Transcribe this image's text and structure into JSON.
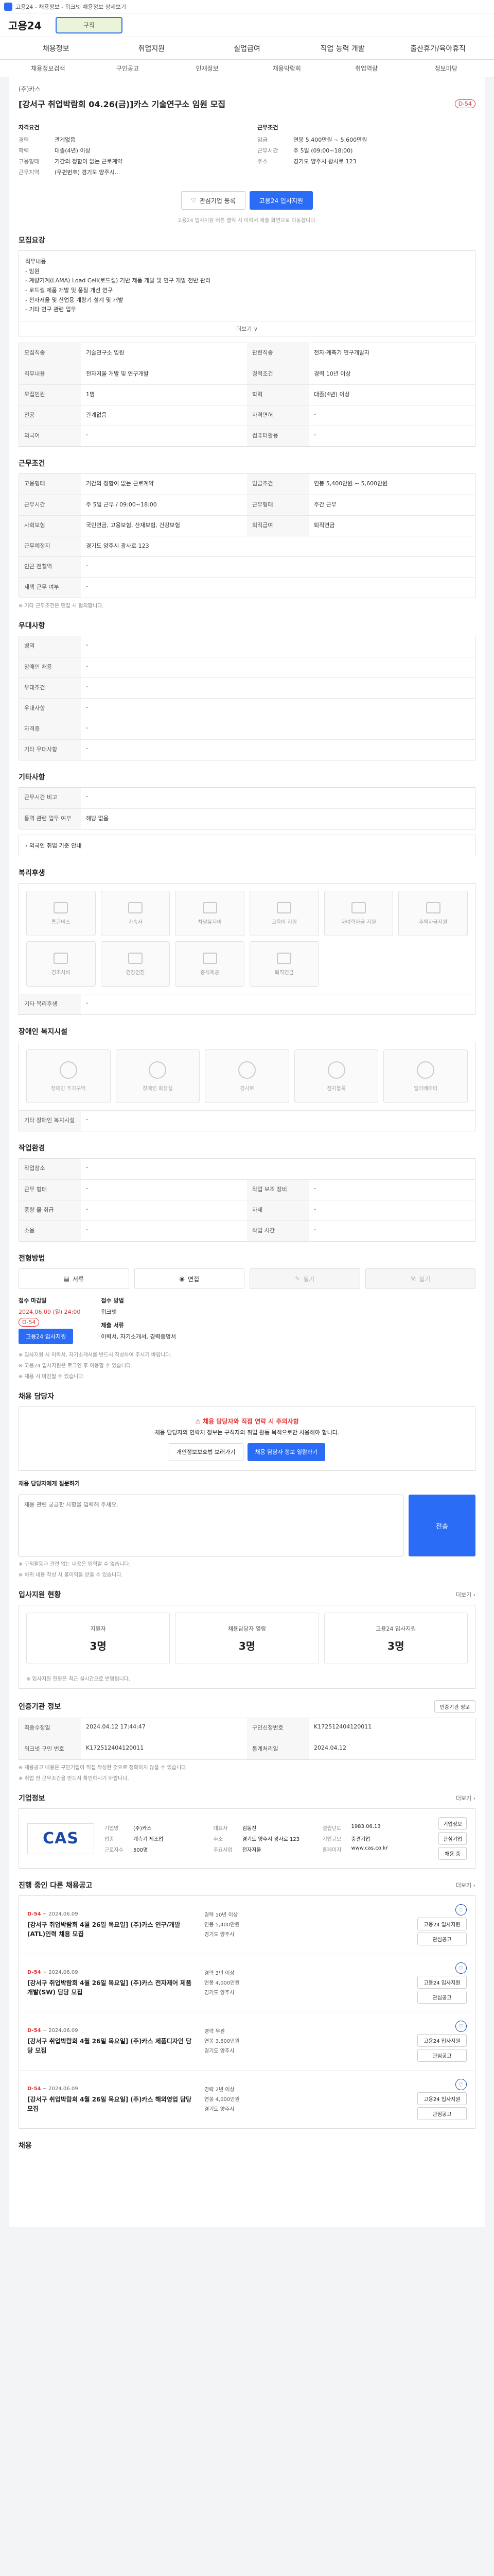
{
  "topbar": {
    "text": "고용24 - 채용정보 - 워크넷 채용정보 상세보기"
  },
  "header": {
    "logo": "고용24",
    "search_placeholder": "구직",
    "nav": [
      "채용정보",
      "취업지원",
      "실업급여",
      "직업 능력 개발",
      "출산휴가/육아휴직"
    ]
  },
  "subnav": [
    "채용정보검색",
    "구인공고",
    "인재정보",
    "채용박람회",
    "취업역량",
    "정보마당"
  ],
  "job": {
    "company": "(주)카스",
    "title": "[강서구 취업박람회 04.26(금)]카스 기술연구소 임원 모집",
    "dday": "D-54",
    "left_label": "자격요건",
    "left": [
      [
        "경력",
        "관계없음"
      ],
      [
        "학력",
        "대졸(4년) 이상"
      ],
      [
        "고용형태",
        "기간의 정함이 없는 근로계약"
      ],
      [
        "근무지역",
        "(우편번호) 경기도 양주시..."
      ]
    ],
    "right_label": "근무조건",
    "right": [
      [
        "임금",
        "연봉 5,400만원 ~ 5,600만원"
      ],
      [
        "근무시간",
        "주 5일 (09:00~18:00)"
      ],
      [
        "주소",
        "경기도 양주시 광사로 123"
      ]
    ],
    "btn_like": "관심기업 등록",
    "btn_apply": "고용24 입사지원",
    "fine": "고용24 입사지원 버튼 클릭 시 이력서 제출 화면으로 이동합니다."
  },
  "sections": {
    "recruit": "모집요강",
    "condition": "근무조건",
    "welfare": "우대사항",
    "etc": "기타사항",
    "facility": "복리후생",
    "access": "장애인 복지시설",
    "company_info": "작업환경",
    "apply_method": "전형방법",
    "contact": "채용 담당자",
    "stats": "입사지원 현황",
    "period": "인증기관 정보",
    "corp": "기업정보",
    "other_jobs": "진행 중인 다른 채용공고",
    "bottom": "채용"
  },
  "recruit": {
    "desc": "직무내용\n- 임원\n- 계량기계(LAMA) Load Cell(로드셀) 기반 제품 개발 및 연구 개발 전반 관리\n- 로드셀 제품 개발 및 품질 개선 연구\n- 전자저울 및 산업용 계량기 설계 및 개발\n- 기타 연구 관련 업무",
    "more": "더보기 ∨",
    "rows": [
      [
        "모집직종",
        "기술연구소 임원",
        "관련직종",
        "전자·계측기 연구개발자"
      ],
      [
        "직무내용",
        "전자저울 개발 및 연구개발",
        "경력조건",
        "경력 10년 이상"
      ],
      [
        "모집인원",
        "1명",
        "학력",
        "대졸(4년) 이상"
      ],
      [
        "전공",
        "관계없음",
        "자격면허",
        "-"
      ],
      [
        "외국어",
        "-",
        "컴퓨터활용",
        "-"
      ]
    ]
  },
  "condition": {
    "rows": [
      [
        "고용형태",
        "기간의 정함이 없는 근로계약",
        "임금조건",
        "연봉 5,400만원 ~ 5,600만원"
      ],
      [
        "근무시간",
        "주 5일 근무 / 09:00~18:00",
        "근무형태",
        "주간 근무"
      ],
      [
        "사회보험",
        "국민연금, 고용보험, 산재보험, 건강보험",
        "퇴직급여",
        "퇴직연금"
      ],
      [
        "근무예정지",
        "경기도 양주시 광사로 123",
        "",
        ""
      ],
      [
        "인근 전철역",
        "-",
        "",
        ""
      ],
      [
        "재택 근무 여부",
        "-",
        "",
        ""
      ]
    ],
    "note": "※ 기타 근무조건은 면접 시 협의합니다."
  },
  "welfare": {
    "rows": [
      [
        "병역",
        "-"
      ],
      [
        "장애인 채용",
        "-"
      ],
      [
        "우대조건",
        "-"
      ],
      [
        "우대사항",
        "-"
      ],
      [
        "자격증",
        "-"
      ],
      [
        "기타 우대사항",
        "-"
      ]
    ]
  },
  "etc": {
    "rows": [
      [
        "근무시간 비고",
        "-"
      ],
      [
        "통역 관련 업무 여부",
        "해당 없음"
      ]
    ],
    "link": "› 외국인 취업 기준 안내"
  },
  "facility": {
    "items": [
      "통근버스",
      "기숙사",
      "차량유지비",
      "교육비 지원",
      "자녀학자금 지원",
      "주택자금지원",
      "경조사비",
      "건강검진",
      "중식제공",
      "퇴직연금"
    ],
    "note": "기타 복리후생",
    "note_val": "-"
  },
  "access": {
    "items": [
      "장애인 주차구역",
      "장애인 화장실",
      "경사로",
      "점자블록",
      "엘리베이터"
    ],
    "note": "기타 장애인 복지시설",
    "note_val": "-"
  },
  "company_env": {
    "rows": [
      [
        "작업장소",
        "-",
        "",
        ""
      ],
      [
        "근무 형태",
        "-",
        "작업 보조 장비",
        "-"
      ],
      [
        "중량 물 취급",
        "-",
        "자세",
        "-"
      ],
      [
        "소음",
        "-",
        "작업 시간",
        "-"
      ]
    ]
  },
  "apply": {
    "methods": [
      "서류",
      "면접",
      "필기",
      "실기"
    ],
    "doc_label": "접수 마감일",
    "doc_date": "2024.06.09 (일) 24:00",
    "method_label": "접수 방법",
    "method_val": "워크넷",
    "dday": "D-54",
    "apply_btn": "고용24 입사지원",
    "files_label": "제출 서류",
    "files_val": "이력서, 자기소개서, 경력증명서",
    "notes": [
      "※ 입사지원 시 이력서, 자기소개서를 반드시 작성하여 주시기 바랍니다.",
      "※ 고용24 입사지원은 로그인 후 이용할 수 있습니다.",
      "※ 채용 시 마감될 수 있습니다."
    ]
  },
  "contact": {
    "warn_title": "채용 담당자와 직접 연락 시 주의사항",
    "warn_body": "채용 담당자의 연락처 정보는 구직자의 취업 활동 목적으로만 사용해야 합니다.",
    "btn1": "개인정보보호법 보러가기",
    "btn2": "채용 담당자 정보 열람하기",
    "inquiry_label": "채용 담당자에게 질문하기",
    "inquiry_placeholder": "채용 관련 궁금한 사항을 입력해 주세요.",
    "send": "전송",
    "notes": [
      "※ 구직활동과 관련 없는 내용은 입력할 수 없습니다.",
      "※ 허위 내용 작성 시 불이익을 받을 수 있습니다."
    ]
  },
  "stats": {
    "more": "더보기 ›",
    "items": [
      [
        "지원자",
        "3명"
      ],
      [
        "채용담당자 열람",
        "3명"
      ],
      [
        "고용24 입사지원",
        "3명"
      ]
    ],
    "note": "※ 입사지원 현황은 최근 실시간으로 반영됩니다."
  },
  "period": {
    "rows": [
      [
        "최종수정일",
        "2024.04.12 17:44:47",
        "구인신청번호",
        "K172512404120011"
      ],
      [
        "워크넷 구인 번호",
        "K172512404120011",
        "통계처리일",
        "2024.04.12"
      ]
    ],
    "btn": "인증기관 정보",
    "notes": [
      "※ 채용공고 내용은 구인기업이 직접 작성한 것으로 정확하지 않을 수 있습니다.",
      "※ 취업 전 근무조건을 반드시 확인하시기 바랍니다."
    ]
  },
  "corp": {
    "logo": "CAS",
    "more": "더보기 ›",
    "info": [
      [
        "기업명",
        "(주)카스"
      ],
      [
        "대표자",
        "김동진"
      ],
      [
        "설립년도",
        "1983.06.13"
      ],
      [
        "업종",
        "계측기 제조업"
      ],
      [
        "주소",
        "경기도 양주시 광사로 123"
      ],
      [
        "기업규모",
        "중견기업"
      ],
      [
        "근로자수",
        "500명"
      ],
      [
        "주요사업",
        "전자저울"
      ],
      [
        "홈페이지",
        "www.cas.co.kr"
      ]
    ],
    "btns": [
      "기업정보",
      "관심기업",
      "채용 중"
    ]
  },
  "other_jobs": {
    "more": "더보기 ›",
    "items": [
      {
        "dday": "D-54",
        "date": "~ 2024.06.09",
        "title": "[강서구 취업박람회 4월 26일 목요일] (주)카스 연구/개발(ATL)인력 채용 모집",
        "m1": "경력 10년 이상",
        "m2": "연봉 5,400만원",
        "m3": "경기도 양주시"
      },
      {
        "dday": "D-54",
        "date": "~ 2024.06.09",
        "title": "[강서구 취업박람회 4월 26일 목요일] (주)카스 전자제어 제품 개발(SW) 담당 모집",
        "m1": "경력 3년 이상",
        "m2": "연봉 4,000만원",
        "m3": "경기도 양주시"
      },
      {
        "dday": "D-54",
        "date": "~ 2024.06.09",
        "title": "[강서구 취업박람회 4월 26일 목요일] (주)카스 제품디자인 담당 모집",
        "m1": "경력 무관",
        "m2": "연봉 3,600만원",
        "m3": "경기도 양주시"
      },
      {
        "dday": "D-54",
        "date": "~ 2024.06.09",
        "title": "[강서구 취업박람회 4월 26일 목요일] (주)카스 해외영업 담당 모집",
        "m1": "경력 2년 이상",
        "m2": "연봉 4,000만원",
        "m3": "경기도 양주시"
      }
    ],
    "j_btn1": "고용24 입사지원",
    "j_btn2": "관심공고"
  }
}
